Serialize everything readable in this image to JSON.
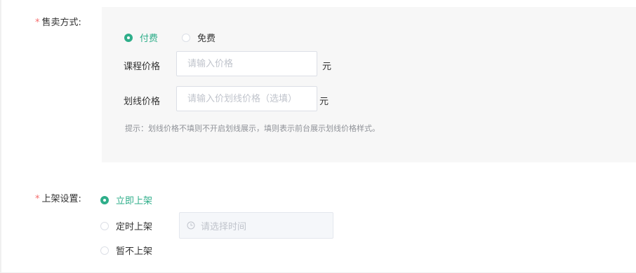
{
  "sale_method": {
    "label": "售卖方式:",
    "options": [
      {
        "label": "付费",
        "checked": true
      },
      {
        "label": "免费",
        "checked": false
      }
    ],
    "course_price": {
      "label": "课程价格",
      "placeholder": "请输入价格",
      "unit": "元"
    },
    "strike_price": {
      "label": "划线价格",
      "placeholder": "请输入价划线价格（选填）",
      "unit": "元"
    },
    "hint": "提示：划线价格不填则不开启划线展示，填则表示前台展示划线价格样式。"
  },
  "listing": {
    "label": "上架设置:",
    "options": [
      {
        "label": "立即上架",
        "checked": true
      },
      {
        "label": "定时上架",
        "checked": false
      },
      {
        "label": "暂不上架",
        "checked": false
      }
    ],
    "time_picker": {
      "placeholder": "请选择时间",
      "icon": "clock-icon"
    }
  },
  "colors": {
    "accent": "#2fae8a",
    "required": "#f56c6c",
    "panel_bg": "#f7f7f7"
  }
}
